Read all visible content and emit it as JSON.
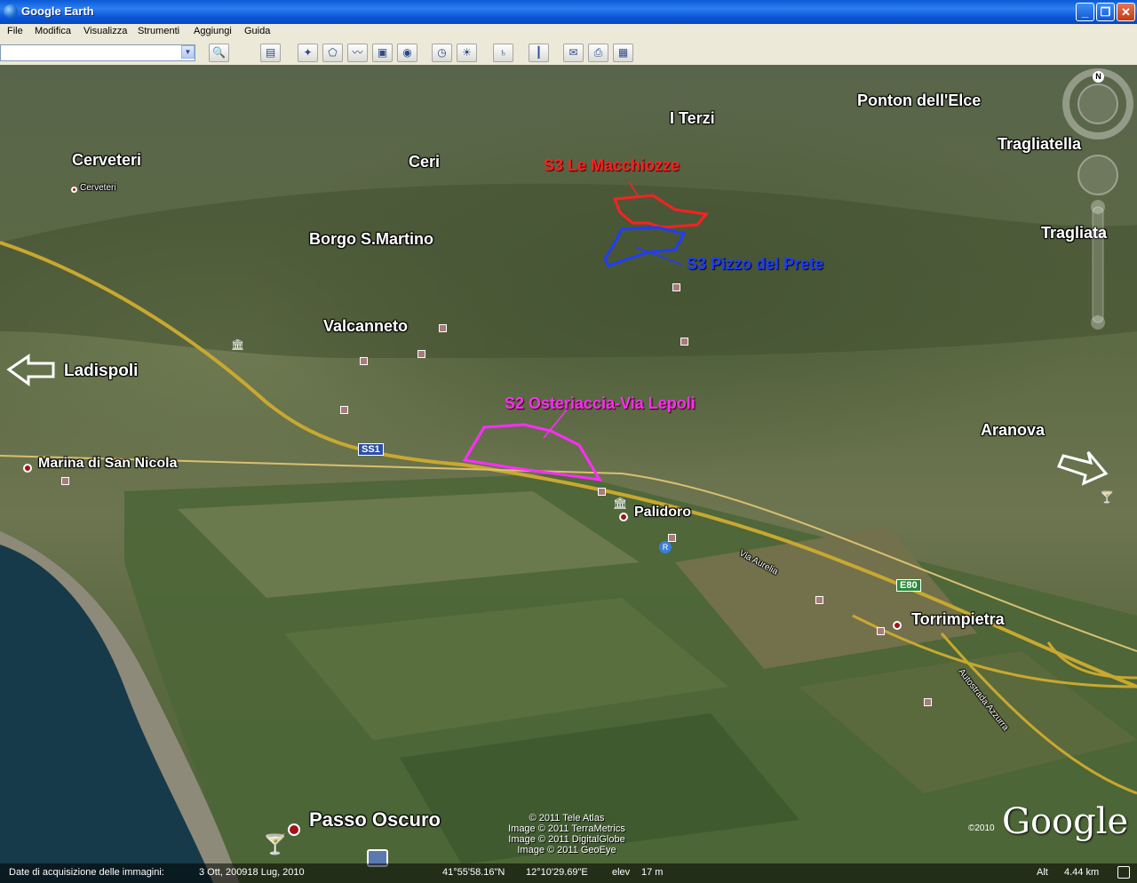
{
  "window": {
    "title": "Google Earth"
  },
  "menu": [
    "File",
    "Modifica",
    "Visualizza",
    "Strumenti",
    "Aggiungi",
    "Guida"
  ],
  "toolbar": {
    "search_value": ""
  },
  "places": {
    "cerveteri": "Cerveteri",
    "cerveteri_small": "Cerveteri",
    "ceri": "Ceri",
    "borgo": "Borgo S.Martino",
    "valcanneto": "Valcanneto",
    "ladispoli": "Ladispoli",
    "marina": "Marina di San Nicola",
    "palidoro": "Palidoro",
    "torrimpietra": "Torrimpietra",
    "passo": "Passo Oscuro",
    "aranova": "Aranova",
    "tragliata": "Tragliata",
    "tragliatella": "Tragliatella",
    "ponton": "Ponton dell'Elce",
    "terzi": "I Terzi"
  },
  "sites": {
    "s3_macchiozze": "S3 Le Macchiozze",
    "s3_pizzo": "S3 Pizzo del Prete",
    "s2_osteriaccia": "S2 Osteriaccia-Via Lepoli"
  },
  "road_labels": {
    "ss1": "SS1",
    "e80": "E80",
    "aurelia": "Via Aurelia",
    "azzurra": "Autostrada Azzurra"
  },
  "attribution": [
    "© 2011 Tele Atlas",
    "Image © 2011 TerraMetrics",
    "Image © 2011 DigitalGlobe",
    "Image © 2011 GeoEye"
  ],
  "logo": {
    "year": "©2010",
    "brand": "Google"
  },
  "status": {
    "date_label": "Date di acquisizione delle immagini:",
    "date_value": "3 Ott, 200918 Lug, 2010",
    "lat": "41°55'58.16\"N",
    "lon": "12°10'29.69\"E",
    "elev_label": "elev",
    "elev_value": "17 m",
    "alt_label": "Alt",
    "alt_value": "4.44 km"
  },
  "nav": {
    "north": "N"
  },
  "colors": {
    "red_site": "#ff2020",
    "blue_site": "#1f3dff",
    "magenta_site": "#ff2cff",
    "road": "#c9a830"
  }
}
